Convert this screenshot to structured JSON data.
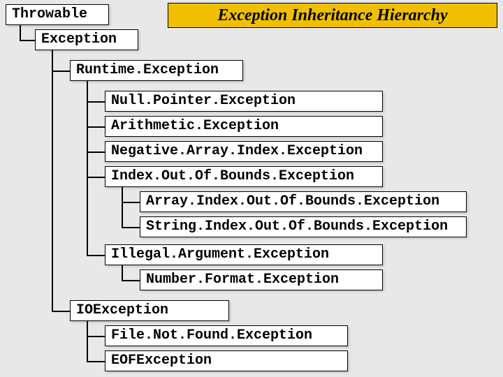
{
  "title": "Exception Inheritance Hierarchy",
  "tree": {
    "throwable": "Throwable",
    "exception": "Exception",
    "runtime": "Runtime.Exception",
    "npe": "Null.Pointer.Exception",
    "arith": "Arithmetic.Exception",
    "naie": "Negative.Array.Index.Exception",
    "ioobe": "Index.Out.Of.Bounds.Exception",
    "aioobe": "Array.Index.Out.Of.Bounds.Exception",
    "sioobe": "String.Index.Out.Of.Bounds.Exception",
    "iae": "Illegal.Argument.Exception",
    "nfe": "Number.Format.Exception",
    "ioex": "IOException",
    "fnfe": "File.Not.Found.Exception",
    "eofe": "EOFException"
  }
}
